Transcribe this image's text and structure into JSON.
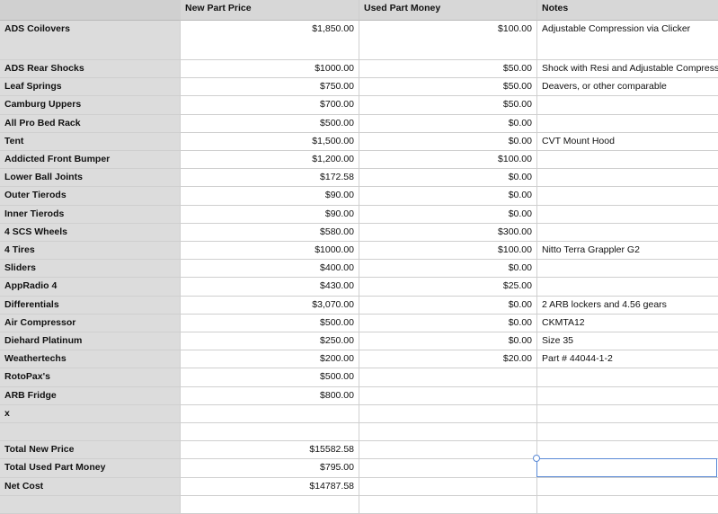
{
  "header": {
    "col0": "",
    "col1": "New Part Price",
    "col2": "Used Part Money",
    "col3": "Notes"
  },
  "rows": [
    {
      "name": "ADS Coilovers",
      "new": "$1,850.00",
      "used": "$100.00",
      "notes": "Adjustable Compression via Clicker"
    },
    {
      "name": "ADS Rear Shocks",
      "new": "$1000.00",
      "used": "$50.00",
      "notes": "Shock with Resi and Adjustable Compression"
    },
    {
      "name": "Leaf Springs",
      "new": "$750.00",
      "used": "$50.00",
      "notes": "Deavers, or other comparable"
    },
    {
      "name": "Camburg Uppers",
      "new": "$700.00",
      "used": "$50.00",
      "notes": ""
    },
    {
      "name": "All Pro Bed Rack",
      "new": "$500.00",
      "used": "$0.00",
      "notes": ""
    },
    {
      "name": "Tent",
      "new": "$1,500.00",
      "used": "$0.00",
      "notes": "CVT Mount Hood"
    },
    {
      "name": "Addicted Front Bumper",
      "new": "$1,200.00",
      "used": "$100.00",
      "notes": ""
    },
    {
      "name": "Lower Ball Joints",
      "new": "$172.58",
      "used": "$0.00",
      "notes": ""
    },
    {
      "name": "Outer Tierods",
      "new": "$90.00",
      "used": "$0.00",
      "notes": ""
    },
    {
      "name": "Inner Tierods",
      "new": "$90.00",
      "used": "$0.00",
      "notes": ""
    },
    {
      "name": "4 SCS Wheels",
      "new": "$580.00",
      "used": "$300.00",
      "notes": ""
    },
    {
      "name": "4 Tires",
      "new": "$1000.00",
      "used": "$100.00",
      "notes": "Nitto Terra Grappler G2"
    },
    {
      "name": "Sliders",
      "new": "$400.00",
      "used": "$0.00",
      "notes": ""
    },
    {
      "name": "AppRadio 4",
      "new": "$430.00",
      "used": "$25.00",
      "notes": ""
    },
    {
      "name": "Differentials",
      "new": "$3,070.00",
      "used": "$0.00",
      "notes": "2 ARB lockers and 4.56 gears"
    },
    {
      "name": "Air Compressor",
      "new": "$500.00",
      "used": "$0.00",
      "notes": "CKMTA12"
    },
    {
      "name": "Diehard Platinum",
      "new": "$250.00",
      "used": "$0.00",
      "notes": "Size 35"
    },
    {
      "name": "Weathertechs",
      "new": "$200.00",
      "used": "$20.00",
      "notes": "Part # 44044-1-2"
    },
    {
      "name": "RotoPax's",
      "new": "$500.00",
      "used": "",
      "notes": ""
    },
    {
      "name": "ARB Fridge",
      "new": "$800.00",
      "used": "",
      "notes": ""
    },
    {
      "name": "x",
      "new": "",
      "used": "",
      "notes": ""
    },
    {
      "name": "",
      "new": "",
      "used": "",
      "notes": ""
    },
    {
      "name": "Total New Price",
      "new": "$15582.58",
      "used": "",
      "notes": ""
    },
    {
      "name": "Total Used Part Money",
      "new": "$795.00",
      "used": "",
      "notes": ""
    },
    {
      "name": "Net Cost",
      "new": "$14787.58",
      "used": "",
      "notes": ""
    },
    {
      "name": "",
      "new": "",
      "used": "",
      "notes": ""
    }
  ]
}
